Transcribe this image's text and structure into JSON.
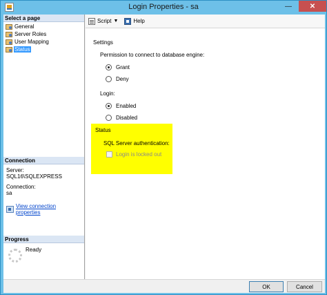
{
  "window": {
    "title": "Login Properties - sa",
    "minimize_glyph": "—",
    "close_glyph": "✕"
  },
  "left_pane": {
    "select_page_header": "Select a page",
    "pages": [
      {
        "label": "General",
        "icon": "wrench-page-icon",
        "selected": false
      },
      {
        "label": "Server Roles",
        "icon": "wrench-page-icon",
        "selected": false
      },
      {
        "label": "User Mapping",
        "icon": "wrench-page-icon",
        "selected": false
      },
      {
        "label": "Status",
        "icon": "wrench-page-icon",
        "selected": true
      }
    ],
    "connection": {
      "header": "Connection",
      "server_label": "Server:",
      "server_value": "SQL16\\SQLEXPRESS",
      "connection_label": "Connection:",
      "connection_value": "sa",
      "link_text": "View connection properties"
    },
    "progress": {
      "header": "Progress",
      "status": "Ready"
    }
  },
  "toolbar": {
    "script_label": "Script",
    "caret_glyph": "▼",
    "help_label": "Help"
  },
  "settings": {
    "title": "Settings",
    "permission_label": "Permission to connect to database engine:",
    "permission_options": [
      {
        "label": "Grant",
        "selected": true
      },
      {
        "label": "Deny",
        "selected": false
      }
    ],
    "login_label": "Login:",
    "login_options": [
      {
        "label": "Enabled",
        "selected": true
      },
      {
        "label": "Disabled",
        "selected": false
      }
    ]
  },
  "status": {
    "title": "Status",
    "sql_auth_label": "SQL Server authentication:",
    "locked_out_label": "Login is locked out",
    "locked_out_checked": false,
    "highlight_color": "#ffff00"
  },
  "footer": {
    "ok_label": "OK",
    "cancel_label": "Cancel"
  }
}
